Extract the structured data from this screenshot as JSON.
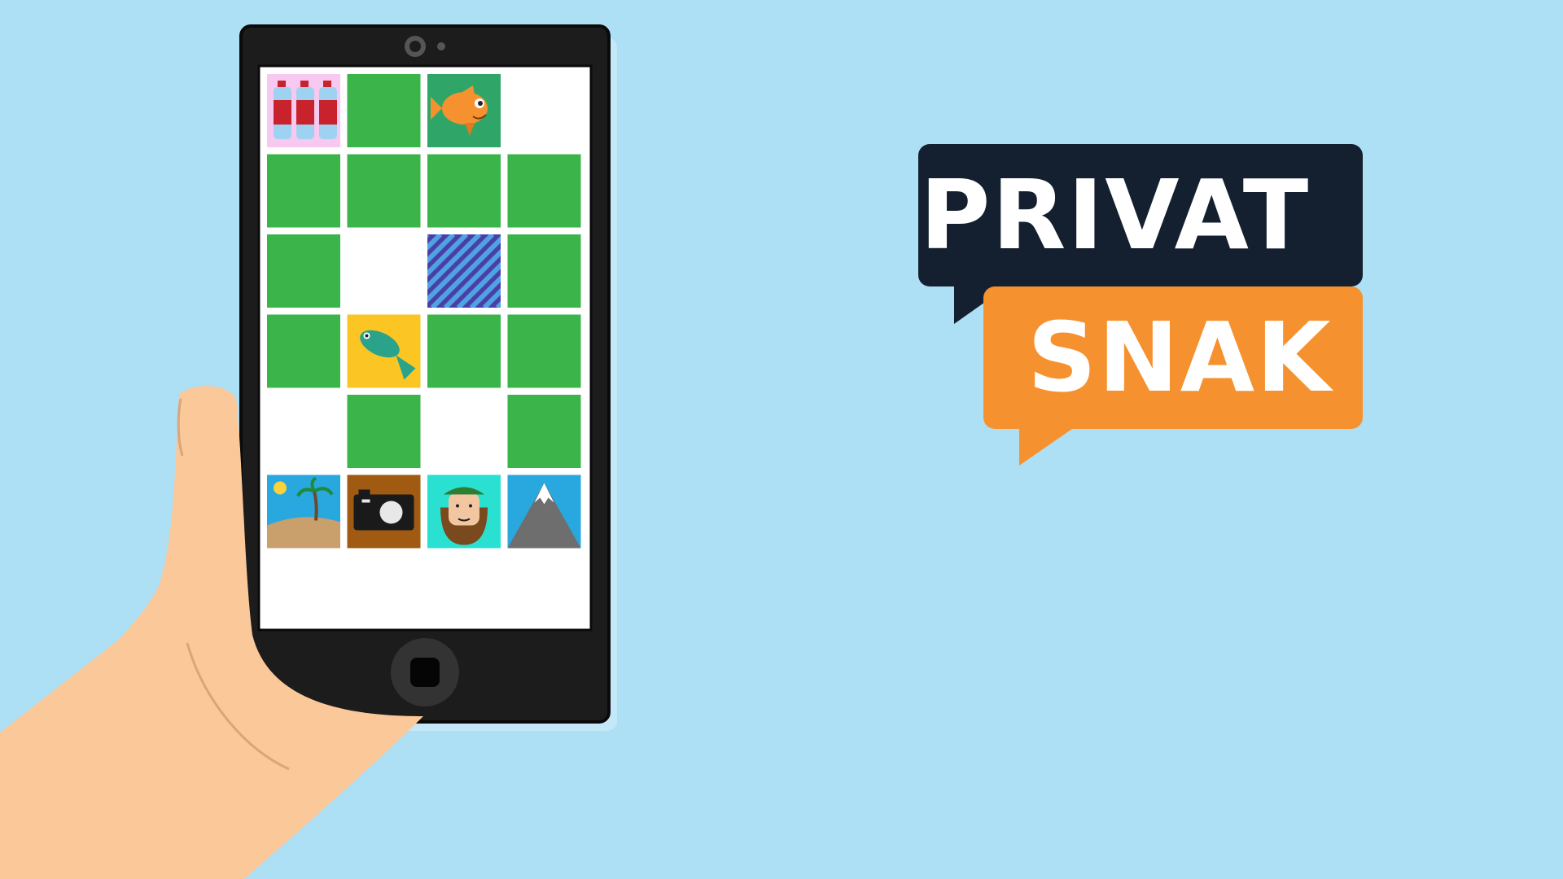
{
  "colors": {
    "background": "#ADDFF5",
    "skin": "#FBC89A",
    "phone_body": "#1C1C1C",
    "screen": "#FFFFFF",
    "tile_green": "#3BB54A",
    "logo_dark": "#14202F",
    "logo_orange": "#F5922F"
  },
  "logo": {
    "line1": "PRIVAT",
    "line2": "SNAK"
  },
  "grid": {
    "rows": [
      [
        "cola-bottles",
        "green",
        "goldfish",
        "empty"
      ],
      [
        "green",
        "green",
        "green",
        "green"
      ],
      [
        "green",
        "empty",
        "striped-pattern",
        "green"
      ],
      [
        "green",
        "green-fish",
        "green",
        "green"
      ],
      [
        "empty",
        "green",
        "empty",
        "green"
      ],
      [
        "beach-palm",
        "camera",
        "bearded-man",
        "mountain"
      ]
    ]
  },
  "icons": {
    "camera_lens": "front-camera-icon",
    "home_button": "home-button-icon"
  }
}
